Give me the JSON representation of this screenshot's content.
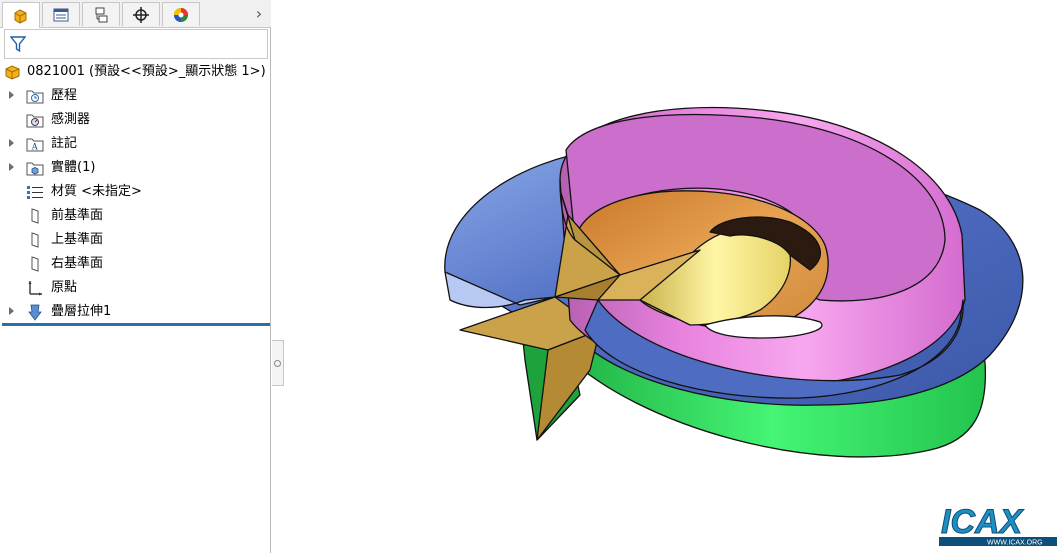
{
  "tabs": [
    {
      "name": "featuremanager",
      "icon": "part-icon"
    },
    {
      "name": "propertymanager",
      "icon": "property-list-icon"
    },
    {
      "name": "configurationmanager",
      "icon": "configuration-icon"
    },
    {
      "name": "dimxpertmanager",
      "icon": "crosshair-icon"
    },
    {
      "name": "displaymanager",
      "icon": "appearance-ball-icon"
    }
  ],
  "tabs_overflow_label": "›",
  "tree": {
    "root_label": "0821001  (預設<<預設>_顯示狀態 1>)",
    "items": [
      {
        "label": "歷程",
        "icon": "history-folder-icon",
        "expandable": true
      },
      {
        "label": "感測器",
        "icon": "sensor-folder-icon",
        "expandable": false
      },
      {
        "label": "註記",
        "icon": "annotations-folder-icon",
        "expandable": true
      },
      {
        "label": "實體(1)",
        "icon": "solid-bodies-folder-icon",
        "expandable": true
      },
      {
        "label": "材質 <未指定>",
        "icon": "material-icon",
        "expandable": false
      },
      {
        "label": "前基準面",
        "icon": "plane-icon",
        "expandable": false
      },
      {
        "label": "上基準面",
        "icon": "plane-icon",
        "expandable": false
      },
      {
        "label": "右基準面",
        "icon": "plane-icon",
        "expandable": false
      },
      {
        "label": "原點",
        "icon": "origin-icon",
        "expandable": false
      },
      {
        "label": "疊層拉伸1",
        "icon": "lofted-boss-icon",
        "expandable": true
      }
    ]
  },
  "logo_text": "ICAX",
  "logo_subtext": "WWW.ICAX.ORG",
  "colors": {
    "pink_face": "#e77ae0",
    "blue_face": "#4f6ec4",
    "green_face": "#2ee65a",
    "gold_face": "#c9a24a",
    "yellow_face": "#f2ec94",
    "orange_face": "#d8963a",
    "selection_bar": "#2c6ea8"
  }
}
